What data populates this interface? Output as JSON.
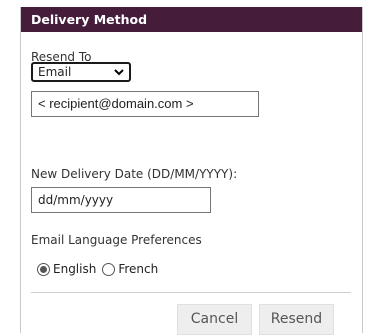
{
  "dialog": {
    "title": "Delivery Method",
    "resend_to_label": "Resend To",
    "channel_select": {
      "value": "Email"
    },
    "recipient_input": {
      "value": "< recipient@domain.com >"
    },
    "delivery_date_label": "New Delivery Date (DD/MM/YYYY):",
    "delivery_date_input": {
      "placeholder": "dd/mm/yyyy"
    },
    "language_label": "Email Language Preferences",
    "languages": [
      {
        "label": "English",
        "selected": true
      },
      {
        "label": "French",
        "selected": false
      }
    ],
    "buttons": {
      "cancel": "Cancel",
      "resend": "Resend"
    }
  },
  "colors": {
    "header_bg": "#461c3b",
    "button_bg": "#eeeeee"
  }
}
